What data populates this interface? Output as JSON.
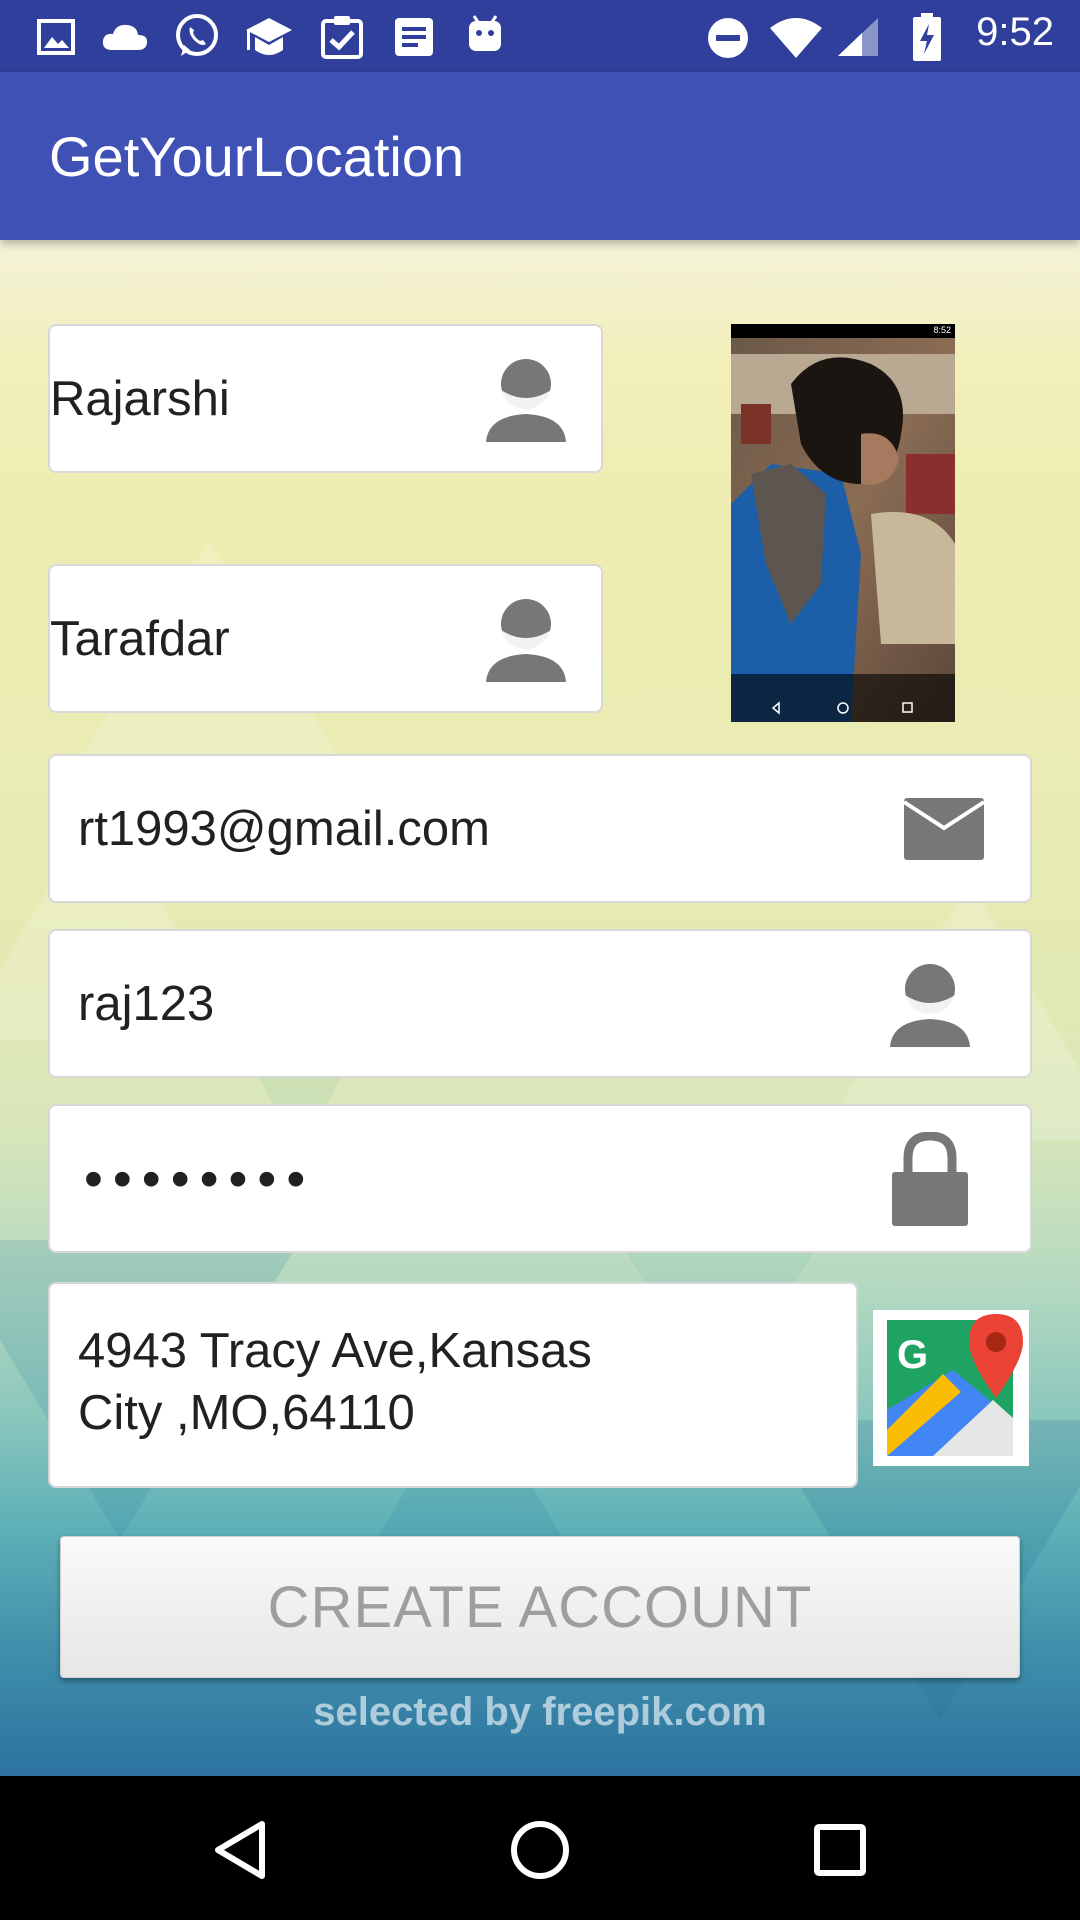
{
  "status_bar": {
    "time": "9:52",
    "left_icons": [
      "gallery-icon",
      "cloud-icon",
      "whatsapp-icon",
      "graduation-cap-icon",
      "clipboard-check-icon",
      "message-icon",
      "android-icon"
    ],
    "right_icons": [
      "do-not-disturb-icon",
      "wifi-icon",
      "signal-icon",
      "battery-charging-icon"
    ]
  },
  "app_bar": {
    "title": "GetYourLocation"
  },
  "form": {
    "first_name": "Rajarshi",
    "last_name": "Tarafdar",
    "email": "rt1993@gmail.com",
    "username": "raj123",
    "password_mask": "••••••••",
    "address_line1": "4943 Tracy Ave,Kansas",
    "address_line2": "City ,MO,64110"
  },
  "profile_photo": {
    "status_time": "8:52"
  },
  "buttons": {
    "create_account": "CREATE ACCOUNT"
  },
  "watermark": "selected by freepik.com",
  "colors": {
    "status_bar": "#2f3f9b",
    "app_bar": "#3f51b5",
    "button_text": "#9e9e9e"
  }
}
